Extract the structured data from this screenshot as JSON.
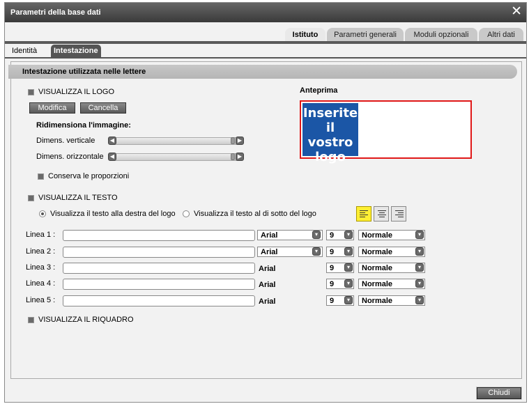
{
  "window": {
    "title": "Parametri della base dati",
    "close_glyph": "✕"
  },
  "top_tabs": [
    {
      "label": "Istituto",
      "active": true
    },
    {
      "label": "Parametri generali",
      "active": false
    },
    {
      "label": "Moduli opzionali",
      "active": false
    },
    {
      "label": "Altri dati",
      "active": false
    }
  ],
  "sub_tabs": [
    {
      "label": "Identità",
      "active": false
    },
    {
      "label": "Intestazione",
      "active": true
    }
  ],
  "section": {
    "title": "Intestazione utilizzata nelle lettere"
  },
  "logo": {
    "show_label": "VISUALIZZA IL LOGO",
    "modify_label": "Modifica",
    "cancel_label": "Cancella",
    "resize_title": "Ridimensiona l'immagine:",
    "vertical_label": "Dimens. verticale",
    "horizontal_label": "Dimens. orizzontale",
    "keep_ratio_label": "Conserva le proporzioni"
  },
  "preview": {
    "label": "Anteprima",
    "logo_lines": [
      "Inserite",
      "il vostro",
      "logo"
    ],
    "logo_color": "#1b56a6",
    "border_color": "#e01818"
  },
  "text": {
    "show_label": "VISUALIZZA IL TESTO",
    "right_label": "Visualizza il testo alla destra del logo",
    "below_label": "Visualizza il testo al di sotto del logo",
    "alignment_selected": "left"
  },
  "lines": [
    {
      "label": "Linea 1 :",
      "value": "",
      "font": "Arial",
      "size": "9",
      "style": "Normale",
      "font_dropdown": true
    },
    {
      "label": "Linea 2 :",
      "value": "",
      "font": "Arial",
      "size": "9",
      "style": "Normale",
      "font_dropdown": true
    },
    {
      "label": "Linea 3 :",
      "value": "",
      "font": "Arial",
      "size": "9",
      "style": "Normale",
      "font_dropdown": false
    },
    {
      "label": "Linea 4 :",
      "value": "",
      "font": "Arial",
      "size": "9",
      "style": "Normale",
      "font_dropdown": false
    },
    {
      "label": "Linea 5 :",
      "value": "",
      "font": "Arial",
      "size": "9",
      "style": "Normale",
      "font_dropdown": false
    }
  ],
  "frame": {
    "show_label": "VISUALIZZA IL RIQUADRO"
  },
  "footer": {
    "close_label": "Chiudi"
  }
}
